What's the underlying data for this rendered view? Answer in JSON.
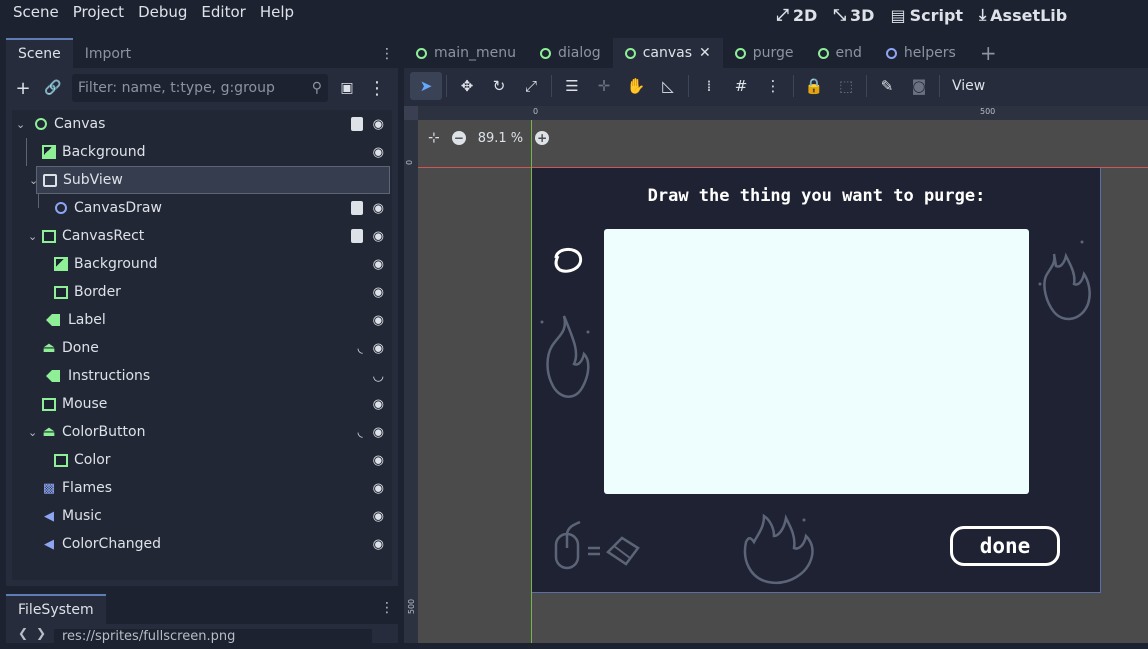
{
  "menu": [
    "Scene",
    "Project",
    "Debug",
    "Editor",
    "Help"
  ],
  "workspaces": [
    {
      "icon": "2d-icon",
      "label": "2D",
      "active": true
    },
    {
      "icon": "3d-icon",
      "label": "3D",
      "active": false
    },
    {
      "icon": "script-icon",
      "label": "Script",
      "active": false
    },
    {
      "icon": "assetlib-icon",
      "label": "AssetLib",
      "active": false
    }
  ],
  "scene_dock": {
    "tabs": [
      "Scene",
      "Import"
    ],
    "filter_placeholder": "Filter: name, t:type, g:group",
    "nodes": [
      {
        "name": "Canvas",
        "icon": "node2d-icon",
        "script": true,
        "visible": true
      },
      {
        "name": "Background",
        "icon": "texture-rect-icon",
        "script": false,
        "visible": true
      },
      {
        "name": "SubView",
        "icon": "subviewport-container-icon",
        "script": false,
        "visible": false
      },
      {
        "name": "CanvasDraw",
        "icon": "node2d-icon",
        "script": true,
        "visible": true
      },
      {
        "name": "CanvasRect",
        "icon": "texture-rect-icon",
        "script": true,
        "visible": true
      },
      {
        "name": "Background",
        "icon": "texture-rect-icon",
        "script": false,
        "visible": true
      },
      {
        "name": "Border",
        "icon": "texture-rect-icon",
        "script": false,
        "visible": true
      },
      {
        "name": "Label",
        "icon": "label-icon",
        "script": false,
        "visible": true
      },
      {
        "name": "Done",
        "icon": "texture-button-icon",
        "signal": true,
        "visible": true
      },
      {
        "name": "Instructions",
        "icon": "label-icon",
        "script": false,
        "visible": false
      },
      {
        "name": "Mouse",
        "icon": "texture-rect-icon",
        "script": false,
        "visible": true
      },
      {
        "name": "ColorButton",
        "icon": "texture-button-icon",
        "signal": true,
        "visible": true
      },
      {
        "name": "Color",
        "icon": "texture-rect-icon",
        "script": false,
        "visible": true
      },
      {
        "name": "Flames",
        "icon": "animated-sprite-icon",
        "script": false,
        "visible": true
      },
      {
        "name": "Music",
        "icon": "audio-player-icon",
        "script": false,
        "visible": true
      },
      {
        "name": "ColorChanged",
        "icon": "audio-player-icon",
        "script": false,
        "visible": true
      }
    ]
  },
  "filesystem": {
    "tab": "FileSystem",
    "path": "res://sprites/fullscreen.png"
  },
  "editor_tabs": [
    {
      "label": "main_menu",
      "active": false
    },
    {
      "label": "dialog",
      "active": false
    },
    {
      "label": "canvas",
      "active": true
    },
    {
      "label": "purge",
      "active": false
    },
    {
      "label": "end",
      "active": false
    },
    {
      "label": "helpers",
      "active": false
    }
  ],
  "toolbar": {
    "view_label": "View"
  },
  "viewport": {
    "zoom": "89.1 %",
    "ruler_top": [
      "0",
      "500"
    ],
    "ruler_left": [
      "0",
      "500"
    ]
  },
  "canvas": {
    "title": "Draw the thing you want to purge:",
    "done_label": "done"
  },
  "colors": {
    "accent": "#64a8ff",
    "canvas_bg": "#1f2232",
    "draw_area": "#eefeff",
    "node_green": "#8eef97",
    "node_blue": "#8da5f3"
  }
}
